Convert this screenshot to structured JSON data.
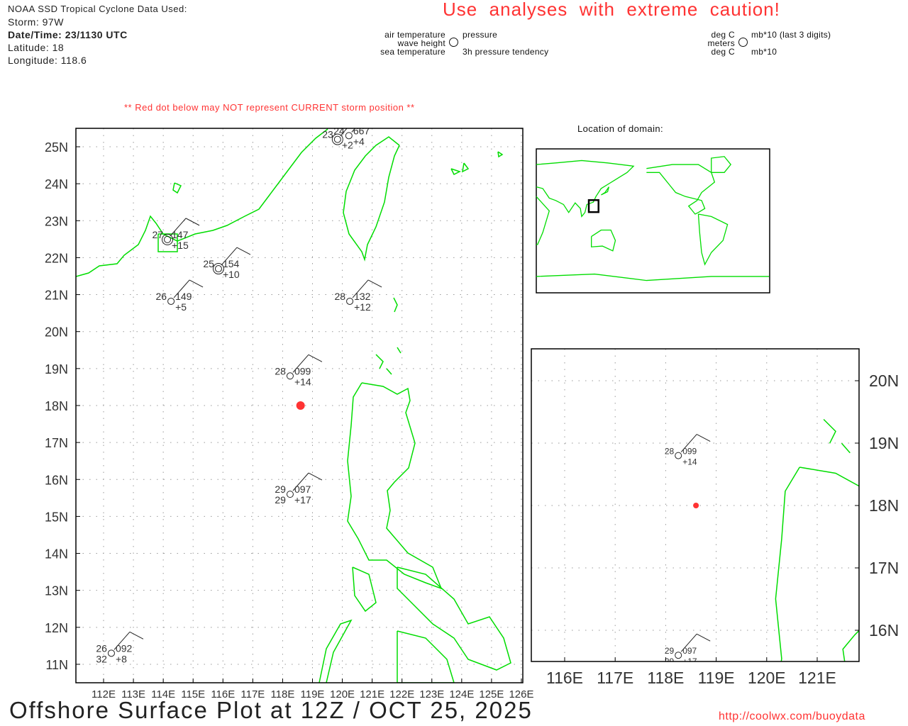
{
  "header": {
    "source": "NOAA SSD Tropical Cyclone Data Used:",
    "storm": "Storm: 97W",
    "datetime": "Date/Time: 23/1130 UTC",
    "latitude": "Latitude: 18",
    "longitude": "Longitude: 118.6",
    "caution": "Use  analyses  with  extreme  caution!",
    "red_dot_note": "** Red dot below may NOT represent CURRENT storm position **",
    "domain_label": "Location of domain:",
    "footer_title": "Offshore Surface Plot at 12Z / OCT 25, 2025",
    "footer_url": "http://coolwx.com/buoydata"
  },
  "legend": {
    "air_temp": "air temperature",
    "wave_height": "wave height",
    "sea_temp": "sea temperature",
    "pressure": "pressure",
    "tendency": "3h pressure tendency",
    "unit_air": "deg C",
    "unit_wave": "meters",
    "unit_sea": "deg C",
    "unit_pressure": "mb*10 (last 3 digits)",
    "unit_tendency": "mb*10"
  },
  "chart_data": {
    "type": "map",
    "main_map": {
      "lon_range": [
        111.1,
        126.1
      ],
      "lat_range": [
        10.5,
        25.5
      ],
      "lon_ticks": [
        "112E",
        "113E",
        "114E",
        "115E",
        "116E",
        "117E",
        "118E",
        "119E",
        "120E",
        "121E",
        "122E",
        "123E",
        "124E",
        "125E",
        "126E"
      ],
      "lat_ticks": [
        "11N",
        "12N",
        "13N",
        "14N",
        "15N",
        "16N",
        "17N",
        "18N",
        "19N",
        "20N",
        "21N",
        "22N",
        "23N",
        "24N",
        "25N"
      ]
    },
    "zoom_map": {
      "lon_range": [
        115.3,
        125.8
      ],
      "lat_range": [
        15.5,
        20.5
      ],
      "lon_ticks": [
        "116E",
        "117E",
        "118E",
        "119E",
        "120E",
        "121E"
      ],
      "lat_ticks": [
        "16N",
        "17N",
        "18N",
        "19N",
        "20N"
      ]
    },
    "storm_position": {
      "lat": 18.0,
      "lon": 118.6,
      "color": "#ff3333"
    },
    "stations": [
      {
        "lat": 22.49,
        "lon": 114.14,
        "air": "27",
        "pressure": "147",
        "tendency": "+15",
        "sea": "",
        "double_circle": true
      },
      {
        "lat": 21.7,
        "lon": 115.85,
        "air": "25",
        "pressure": "154",
        "tendency": "+10",
        "sea": "",
        "double_circle": true
      },
      {
        "lat": 20.82,
        "lon": 114.26,
        "air": "26",
        "pressure": "149",
        "tendency": "+5",
        "sea": "",
        "double_circle": false
      },
      {
        "lat": 20.82,
        "lon": 120.25,
        "air": "28",
        "pressure": "132",
        "tendency": "+12",
        "sea": "",
        "double_circle": false
      },
      {
        "lat": 18.8,
        "lon": 118.25,
        "air": "28",
        "pressure": "099",
        "tendency": "+14",
        "sea": "",
        "double_circle": false
      },
      {
        "lat": 15.6,
        "lon": 118.25,
        "air": "29",
        "pressure": "097",
        "tendency": "+17",
        "sea": "29",
        "double_circle": false
      },
      {
        "lat": 11.3,
        "lon": 112.26,
        "air": "26",
        "pressure": "092",
        "tendency": "+8",
        "sea": "32",
        "double_circle": false
      },
      {
        "lat": 25.2,
        "lon": 119.84,
        "air": "23",
        "pressure": "",
        "tendency": "+2",
        "sea": "",
        "double_circle": true
      },
      {
        "lat": 25.3,
        "lon": 120.22,
        "air": "24",
        "pressure": "667",
        "tendency": "+4",
        "sea": "",
        "double_circle": false
      }
    ],
    "colors": {
      "coast": "#00dd00",
      "grid": "#999999",
      "storm": "#ff3333"
    }
  }
}
